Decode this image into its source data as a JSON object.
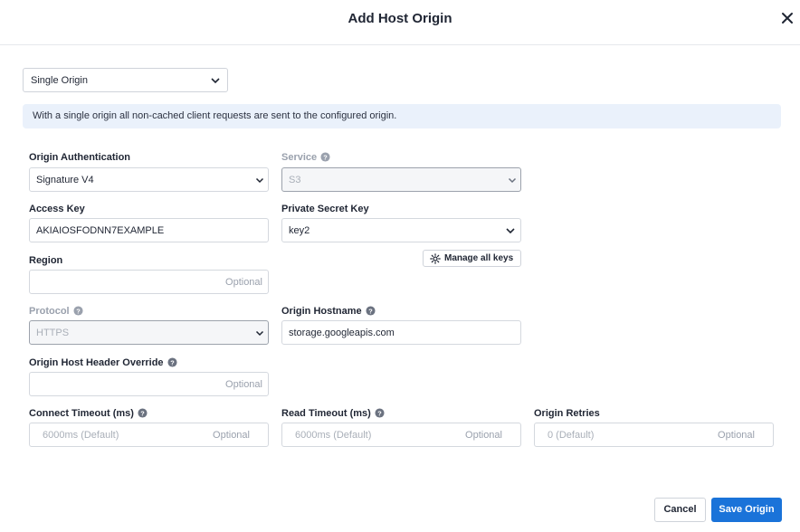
{
  "dialog": {
    "title": "Add Host Origin",
    "close_icon": "close-icon"
  },
  "origin_type": {
    "selected": "Single Origin"
  },
  "info_banner": "With a single origin all non-cached client requests are sent to the configured origin.",
  "fields": {
    "origin_authentication": {
      "label": "Origin Authentication",
      "value": "Signature V4"
    },
    "service": {
      "label": "Service",
      "value": "S3"
    },
    "access_key": {
      "label": "Access Key",
      "value": "AKIAIOSFODNN7EXAMPLE"
    },
    "private_secret_key": {
      "label": "Private Secret Key",
      "value": "key2"
    },
    "manage_keys_label": "Manage all keys",
    "region": {
      "label": "Region",
      "placeholder": "Optional"
    },
    "protocol": {
      "label": "Protocol",
      "value": "HTTPS"
    },
    "origin_hostname": {
      "label": "Origin Hostname",
      "value": "storage.googleapis.com"
    },
    "host_header_override": {
      "label": "Origin Host Header Override",
      "placeholder": "Optional"
    },
    "connect_timeout": {
      "label": "Connect Timeout (ms)",
      "default": "6000ms (Default)",
      "placeholder": "Optional"
    },
    "read_timeout": {
      "label": "Read Timeout (ms)",
      "default": "6000ms (Default)",
      "placeholder": "Optional"
    },
    "origin_retries": {
      "label": "Origin Retries",
      "default": "0 (Default)",
      "placeholder": "Optional"
    }
  },
  "footer": {
    "cancel_label": "Cancel",
    "save_label": "Save Origin"
  },
  "colors": {
    "primary": "#1a73d9",
    "banner_bg": "#eaf1fb",
    "border": "#d4d8de"
  }
}
